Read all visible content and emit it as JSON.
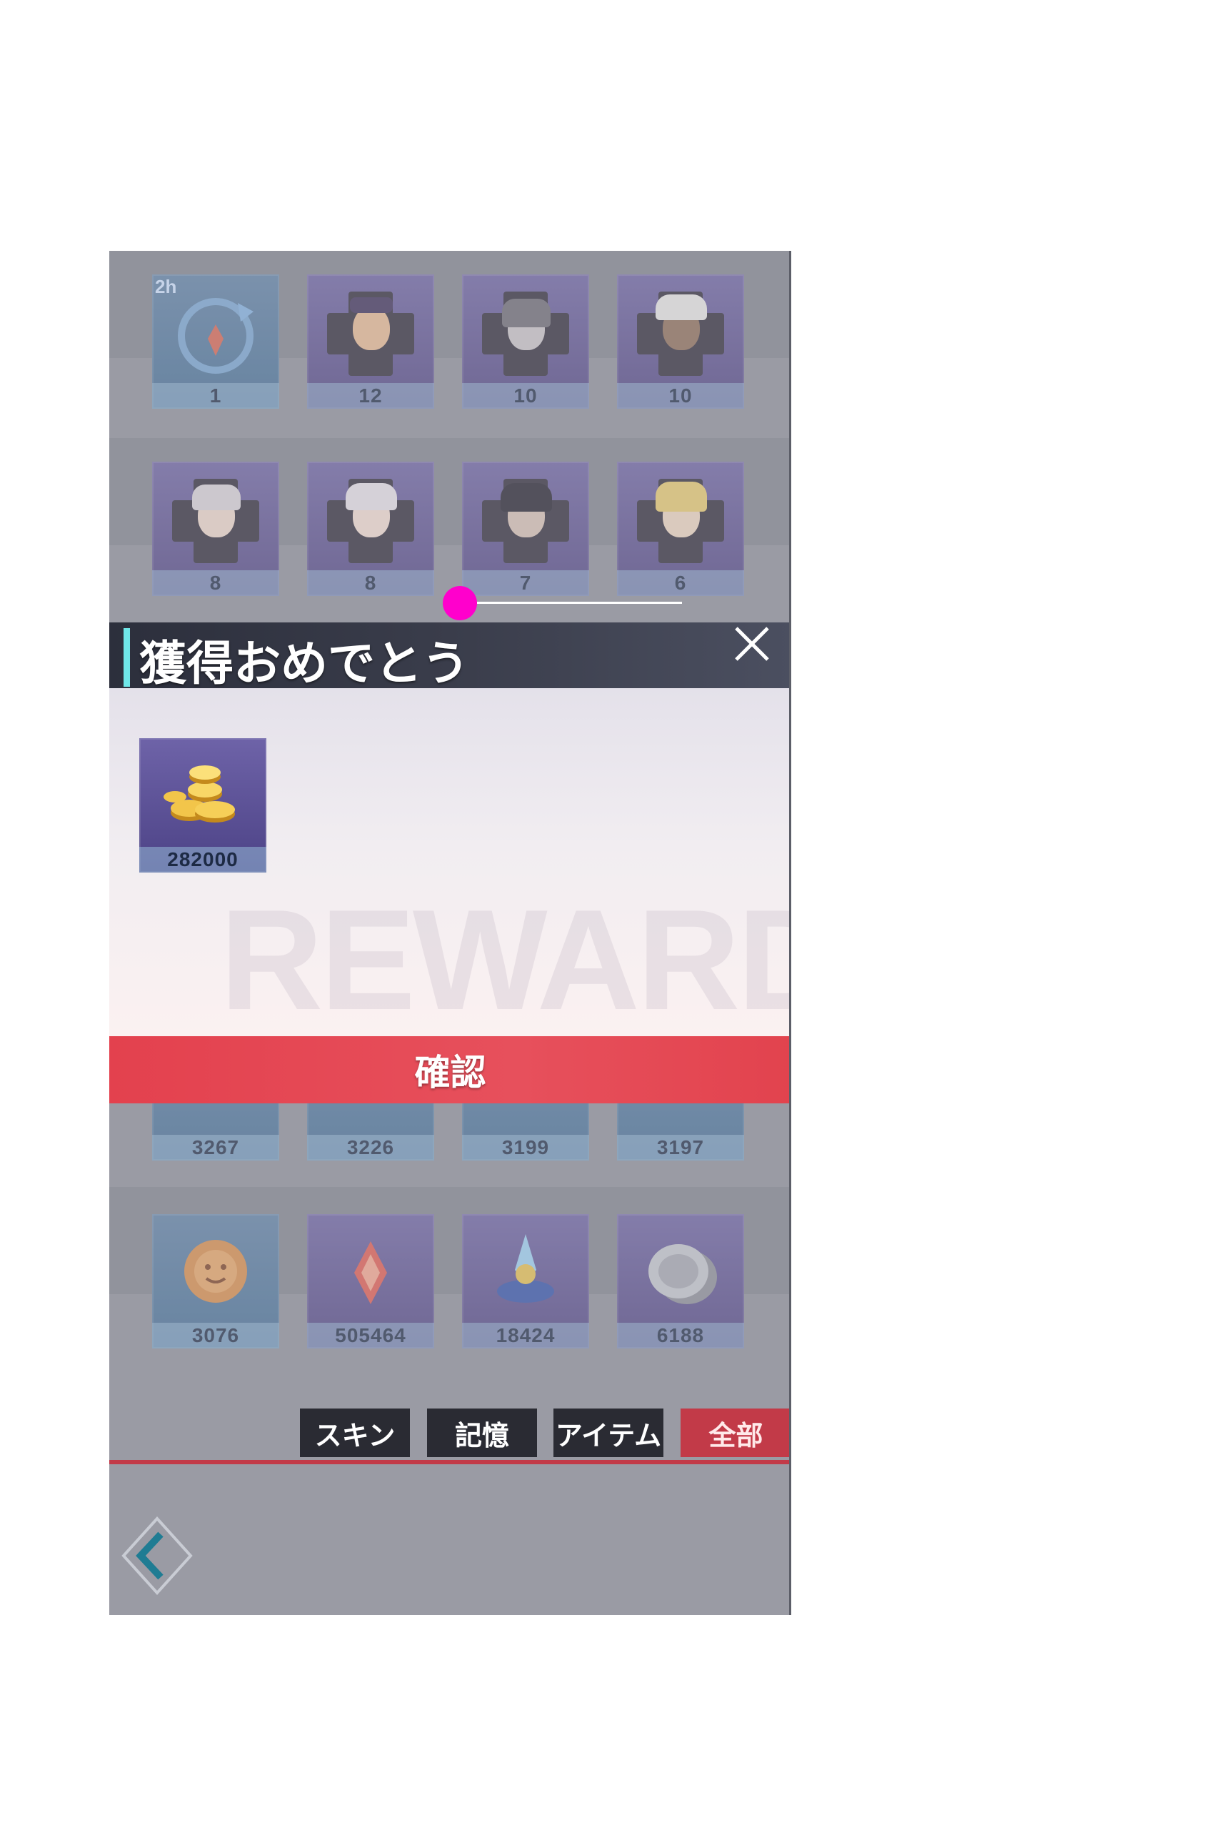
{
  "grid": {
    "row1": [
      {
        "count": "1",
        "badge": "2h"
      },
      {
        "count": "12"
      },
      {
        "count": "10"
      },
      {
        "count": "10"
      }
    ],
    "row2": [
      {
        "count": "8"
      },
      {
        "count": "8"
      },
      {
        "count": "7"
      },
      {
        "count": "6"
      }
    ],
    "row3": [
      {
        "count": "3267"
      },
      {
        "count": "3226"
      },
      {
        "count": "3199"
      },
      {
        "count": "3197"
      }
    ],
    "row4": [
      {
        "count": "3076"
      },
      {
        "count": "505464"
      },
      {
        "count": "18424"
      },
      {
        "count": "6188"
      }
    ]
  },
  "dialog": {
    "title": "獲得おめでとう",
    "watermark": "REWARD",
    "reward": {
      "count": "282000",
      "icon": "gold-coins-icon"
    },
    "confirm_label": "確認"
  },
  "tabs": [
    {
      "label": "スキン"
    },
    {
      "label": "記憶"
    },
    {
      "label": "アイテム"
    },
    {
      "label": "全部",
      "active": true
    }
  ],
  "colors": {
    "accent": "#6fe7e8",
    "confirm": "#e3414e",
    "tab_active": "#c23a48",
    "marker": "#ff00cc"
  }
}
